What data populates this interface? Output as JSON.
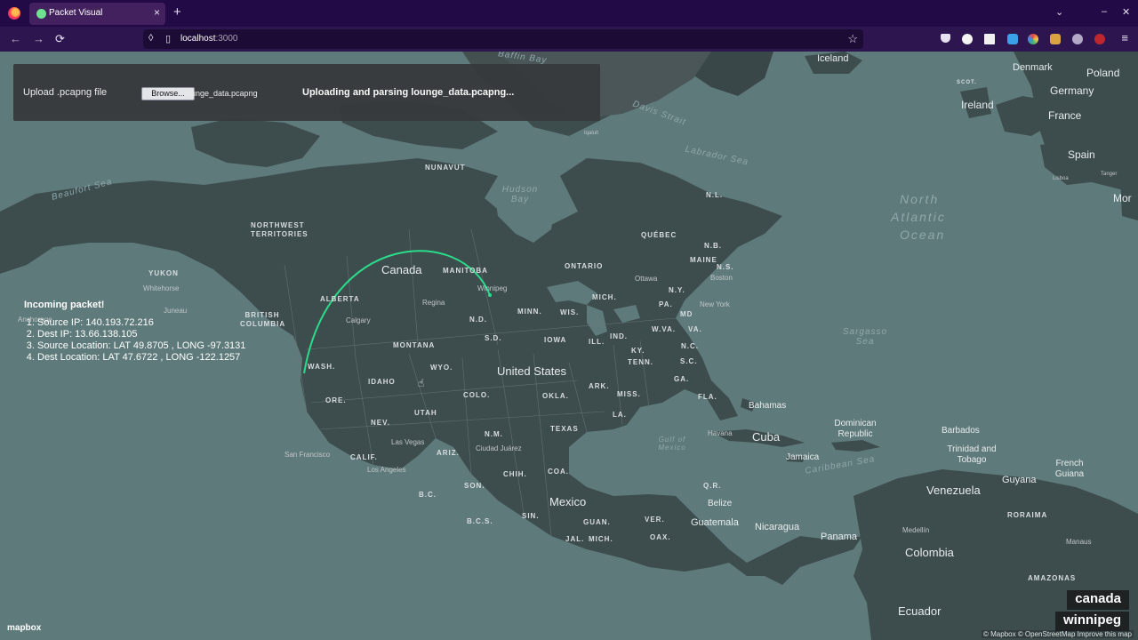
{
  "browser": {
    "tab_title": "Packet Visual",
    "tab_close": "×",
    "new_tab": "+",
    "url": "localhost:3000",
    "url_host": "localhost",
    "url_port": ":3000",
    "window_controls": [
      "⌄",
      "–",
      "✕"
    ],
    "nav": {
      "back": "←",
      "forward": "→",
      "reload": "⟳"
    },
    "star": "☆",
    "menu": "≡",
    "extension_icons": [
      "pocket-icon",
      "account-icon",
      "extension-icon",
      "extension-icon",
      "extension-icon",
      "extension-icon",
      "extension-icon",
      "extension-icon"
    ]
  },
  "upload": {
    "label": "Upload .pcapng file",
    "browse_label": "Browse...",
    "file_name": "lounge_data.pcapng",
    "status": "Uploading and parsing lounge_data.pcapng..."
  },
  "packet": {
    "title": "Incoming packet!",
    "items": [
      "Source IP: 140.193.72.216",
      "Dest IP: 13.66.138.105",
      "Source Location: LAT 49.8705 , LONG -97.3131",
      "Dest Location: LAT 47.6722 , LONG -122.1257"
    ]
  },
  "location": {
    "country": "canada",
    "city": "winnipeg"
  },
  "map": {
    "logo": "mapbox",
    "attribution": "© Mapbox © OpenStreetMap Improve this map",
    "arc_color": "#2bdc8a",
    "land_color": "#3d4c4d",
    "water_color": "#5f7a7a",
    "countries": [
      "Canada",
      "United States",
      "Mexico",
      "Cuba",
      "Venezuela",
      "Colombia",
      "Ecuador",
      "Guatemala",
      "Nicaragua",
      "Panama",
      "Belize",
      "Bahamas",
      "Jamaica",
      "Guyana",
      "Iceland",
      "Ireland",
      "Denmark",
      "Poland",
      "Germany",
      "France",
      "Spain",
      "Dominican Republic",
      "Barbados",
      "Trinidad and Tobago",
      "French Guiana",
      "Mor"
    ],
    "regions": [
      "NUNAVUT",
      "NORTHWEST TERRITORIES",
      "YUKON",
      "BRITISH COLUMBIA",
      "ALBERTA",
      "MANITOBA",
      "ONTARIO",
      "QUÉBEC",
      "N.L.",
      "N.B.",
      "N.S.",
      "MAINE",
      "WASH.",
      "ORE.",
      "IDAHO",
      "MONTANA",
      "WYO.",
      "UTAH",
      "NEV.",
      "CALIF.",
      "ARIZ.",
      "N.M.",
      "COLO.",
      "TEXAS",
      "OKLA.",
      "N.D.",
      "S.D.",
      "MINN.",
      "WIS.",
      "IOWA",
      "ILL.",
      "IND.",
      "MICH.",
      "KY.",
      "TENN.",
      "ARK.",
      "MISS.",
      "LA.",
      "GA.",
      "FLA.",
      "S.C.",
      "N.C.",
      "W.VA.",
      "VA.",
      "MD",
      "PA.",
      "N.Y.",
      "CHIH.",
      "SON.",
      "COA.",
      "B.C.",
      "B.C.S.",
      "SIN.",
      "JAL.",
      "MICH.",
      "OAX.",
      "VER.",
      "GUAN.",
      "Q.R.",
      "RORAIMA",
      "AMAZONAS",
      "SCOT."
    ],
    "cities": [
      "Whitehorse",
      "Anchorage",
      "Juneau",
      "Calgary",
      "Regina",
      "Winnipeg",
      "Ottawa",
      "Boston",
      "New York",
      "Las Vegas",
      "San Francisco",
      "Los Angeles",
      "Ciudad Juárez",
      "Havana",
      "Medellín",
      "Manaus",
      "Iqaluit",
      "Lisboa",
      "Tanger"
    ],
    "waters": [
      "Beaufort Sea",
      "Hudson Bay",
      "Baffin Bay",
      "Davis Strait",
      "Labrador Sea",
      "Gulf of Mexico",
      "Caribbean Sea",
      "Sargasso Sea"
    ],
    "oceans": [
      "North",
      "Atlantic",
      "Ocean"
    ]
  }
}
